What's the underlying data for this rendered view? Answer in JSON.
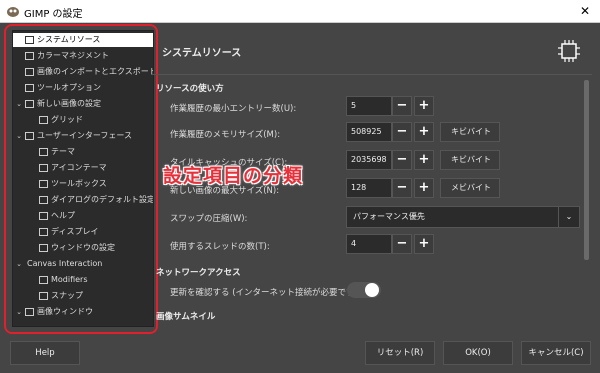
{
  "window": {
    "title": "GIMP の設定",
    "close_glyph": "✕"
  },
  "sidebar": {
    "items": [
      {
        "label": "システムリソース",
        "icon": "chip-icon",
        "level": 0,
        "expander": "",
        "selected": true
      },
      {
        "label": "カラーマネジメント",
        "icon": "color-management-icon",
        "level": 0,
        "expander": ""
      },
      {
        "label": "画像のインポートとエクスポート",
        "icon": "import-export-icon",
        "level": 0,
        "expander": ""
      },
      {
        "label": "ツールオプション",
        "icon": "tool-options-icon",
        "level": 0,
        "expander": ""
      },
      {
        "label": "新しい画像の設定",
        "icon": "new-image-icon",
        "level": 0,
        "expander": "⌄"
      },
      {
        "label": "グリッド",
        "icon": "grid-icon",
        "level": 1,
        "expander": ""
      },
      {
        "label": "ユーザーインターフェース",
        "icon": "user-interface-icon",
        "level": 0,
        "expander": "⌄"
      },
      {
        "label": "テーマ",
        "icon": "theme-icon",
        "level": 1,
        "expander": ""
      },
      {
        "label": "アイコンテーマ",
        "icon": "icon-theme-icon",
        "level": 1,
        "expander": ""
      },
      {
        "label": "ツールボックス",
        "icon": "toolbox-icon",
        "level": 1,
        "expander": ""
      },
      {
        "label": "ダイアログのデフォルト設定",
        "icon": "dialog-defaults-icon",
        "level": 1,
        "expander": ""
      },
      {
        "label": "ヘルプ",
        "icon": "help-icon",
        "level": 1,
        "expander": ""
      },
      {
        "label": "ディスプレイ",
        "icon": "display-icon",
        "level": 1,
        "expander": ""
      },
      {
        "label": "ウィンドウの設定",
        "icon": "window-settings-icon",
        "level": 1,
        "expander": ""
      },
      {
        "label": "Canvas Interaction",
        "icon": "",
        "level": 0,
        "expander": "⌄"
      },
      {
        "label": "Modifiers",
        "icon": "modifiers-icon",
        "level": 1,
        "expander": ""
      },
      {
        "label": "スナップ",
        "icon": "snap-icon",
        "level": 1,
        "expander": ""
      },
      {
        "label": "画像ウィンドウ",
        "icon": "image-window-icon",
        "level": 0,
        "expander": "⌄"
      }
    ]
  },
  "main": {
    "title": "システムリソース",
    "icon": "chip-icon",
    "resource_section": "リソースの使い方",
    "network_section": "ネットワークアクセス",
    "thumb_section": "画像サムネイル",
    "rows": [
      {
        "label": "作業履歴の最小エントリー数(U):",
        "value": "5",
        "unit": ""
      },
      {
        "label": "作業履歴のメモリサイズ(M):",
        "value": "508925",
        "unit": "キビバイト"
      },
      {
        "label": "タイルキャッシュのサイズ(C):",
        "value": "2035698",
        "unit": "キビバイト"
      },
      {
        "label": "新しい画像の最大サイズ(N):",
        "value": "128",
        "unit": "メビバイト"
      }
    ],
    "swap": {
      "label": "スワップの圧縮(W):",
      "value": "パフォーマンス優先"
    },
    "threads": {
      "label": "使用するスレッドの数(T):",
      "value": "4"
    },
    "update": {
      "label": "更新を確認する (インターネット接続が必要です)",
      "enabled": true
    }
  },
  "overlay_caption": "設定項目の分類",
  "buttons": {
    "help": "Help",
    "reset": "リセット(R)",
    "ok": "OK(O)",
    "cancel": "キャンセル(C)"
  },
  "glyphs": {
    "minus": "−",
    "plus": "+",
    "chevron": "⌄"
  },
  "colors": {
    "highlight": "#e0202c",
    "caption": "#e8303a"
  }
}
